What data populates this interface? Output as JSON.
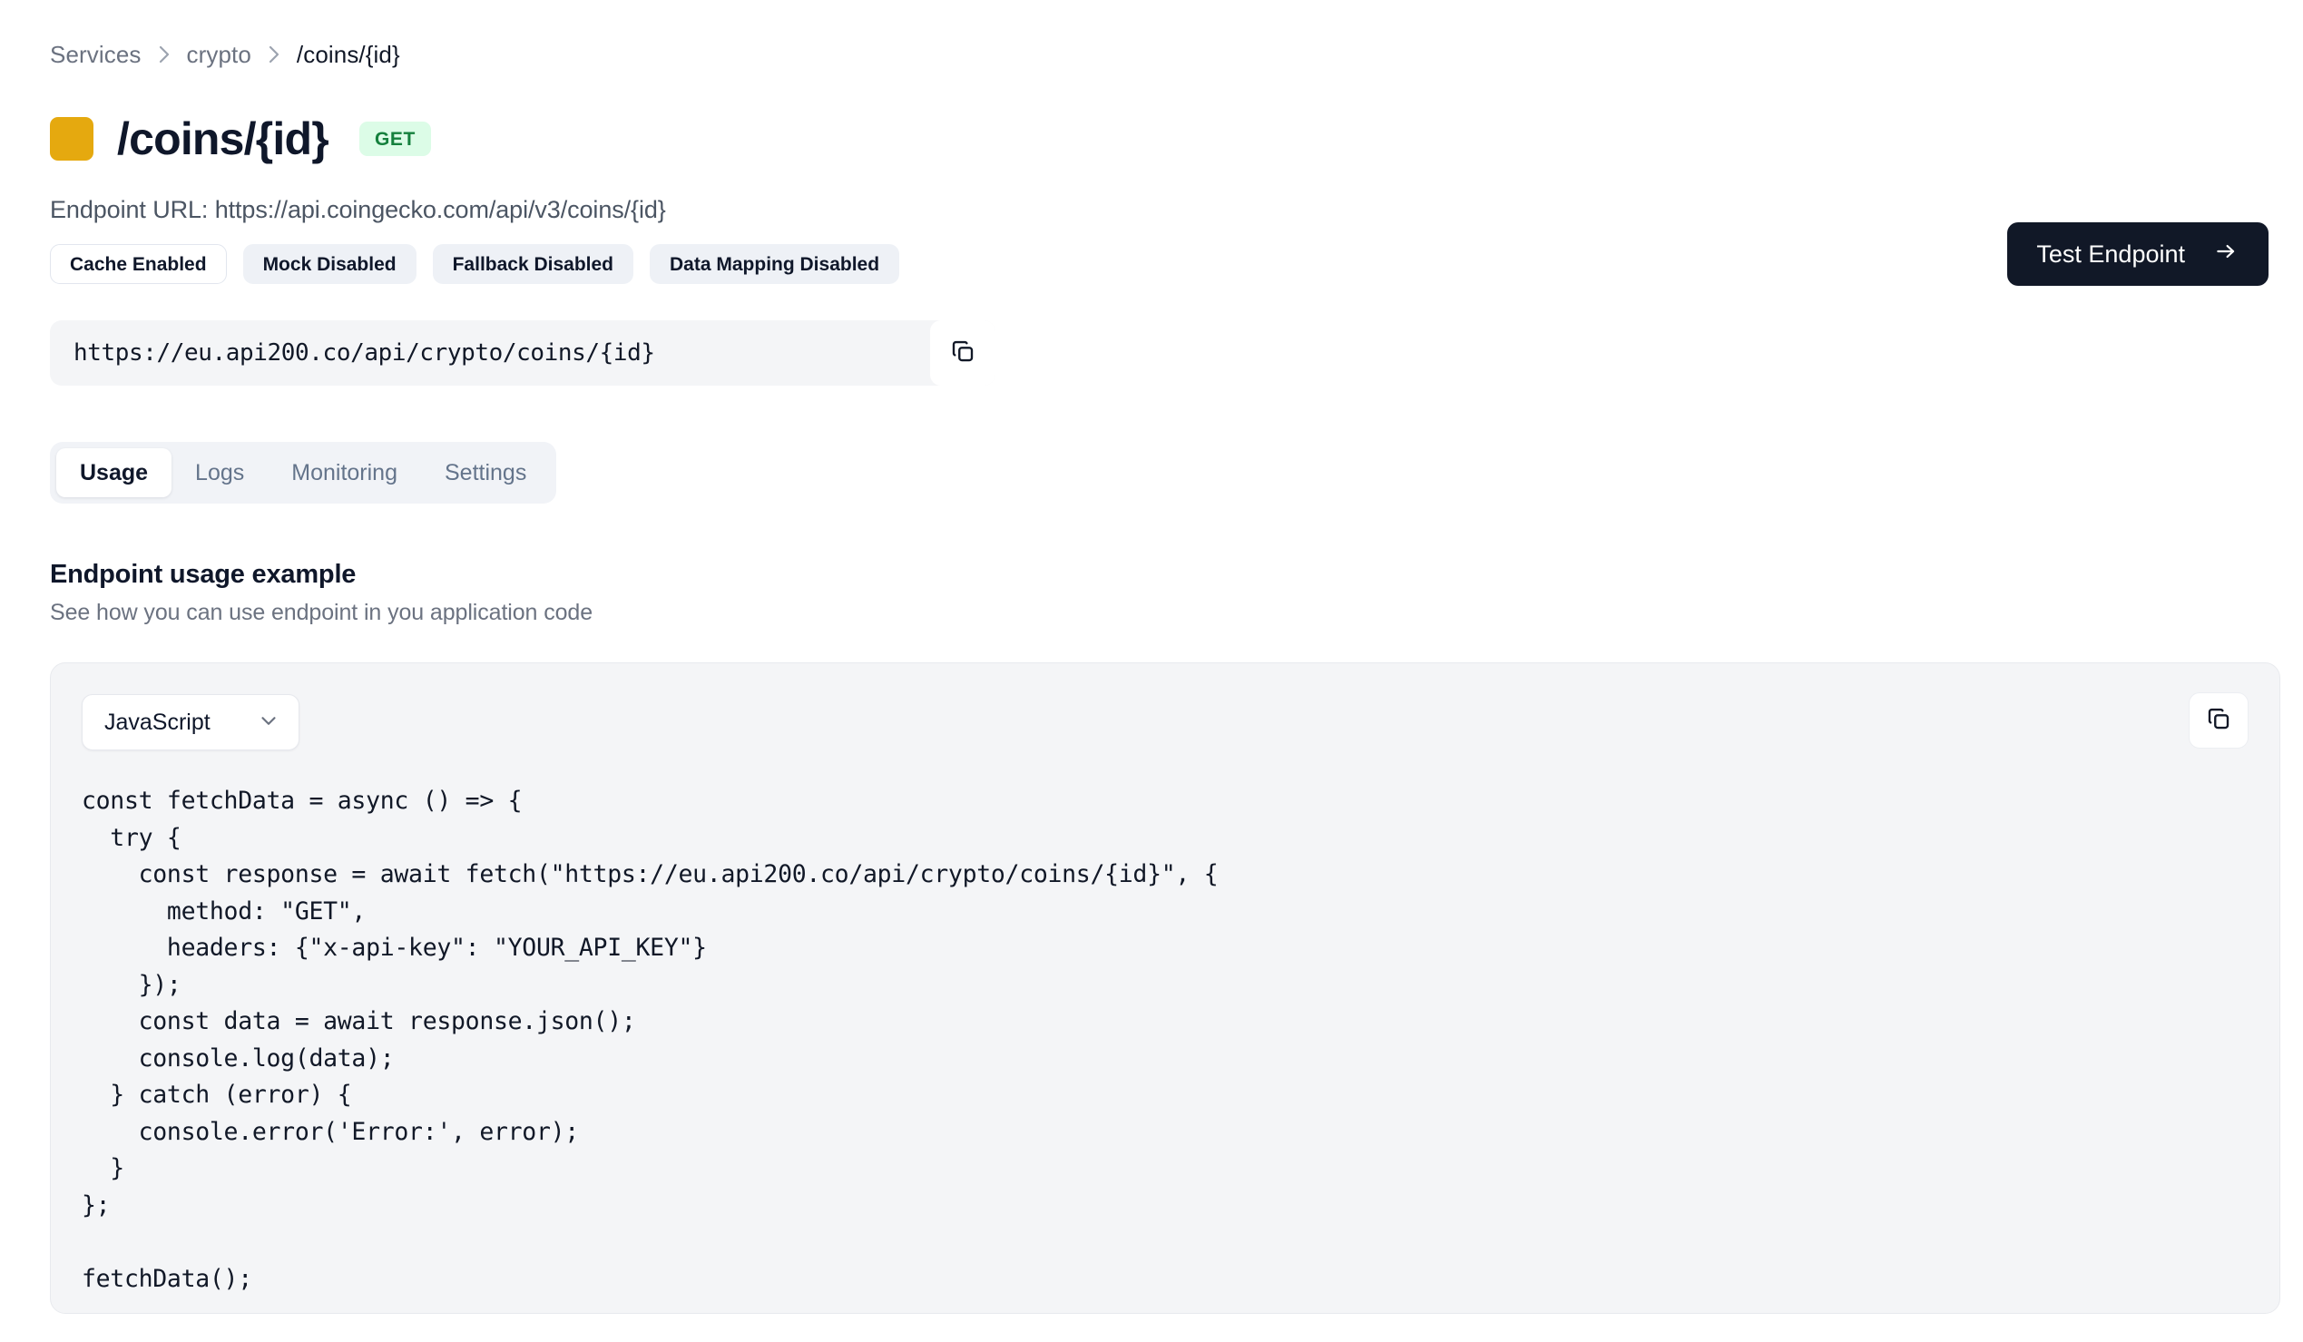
{
  "breadcrumb": {
    "items": [
      {
        "label": "Services",
        "current": false
      },
      {
        "label": "crypto",
        "current": false
      },
      {
        "label": "/coins/{id}",
        "current": true
      }
    ],
    "separator_icon": "chevron-right-icon"
  },
  "header": {
    "color_chip": "#e5a90f",
    "title": "/coins/{id}",
    "method": "GET",
    "method_bg": "#dcfce7",
    "method_color": "#15803d",
    "endpoint_url_line": "Endpoint URL: https://api.coingecko.com/api/v3/coins/{id}",
    "test_button": {
      "label": "Test Endpoint",
      "icon": "arrow-right-icon",
      "bg": "#111827"
    }
  },
  "feature_badges": [
    {
      "label": "Cache Enabled",
      "state": "enabled"
    },
    {
      "label": "Mock Disabled",
      "state": "disabled"
    },
    {
      "label": "Fallback Disabled",
      "state": "disabled"
    },
    {
      "label": "Data Mapping Disabled",
      "state": "disabled"
    }
  ],
  "proxy_url": {
    "value": "https://eu.api200.co/api/crypto/coins/{id}",
    "copy_icon": "copy-icon"
  },
  "tabs": [
    {
      "label": "Usage",
      "active": true
    },
    {
      "label": "Logs",
      "active": false
    },
    {
      "label": "Monitoring",
      "active": false
    },
    {
      "label": "Settings",
      "active": false
    }
  ],
  "usage_section": {
    "title": "Endpoint usage example",
    "subtitle": "See how you can use endpoint in you application code"
  },
  "code_panel": {
    "language_selected": "JavaScript",
    "language_chevron": "chevron-down-icon",
    "copy_icon": "copy-icon",
    "code": "const fetchData = async () => {\n  try {\n    const response = await fetch(\"https://eu.api200.co/api/crypto/coins/{id}\", {\n      method: \"GET\",\n      headers: {\"x-api-key\": \"YOUR_API_KEY\"}\n    });\n    const data = await response.json();\n    console.log(data);\n  } catch (error) {\n    console.error('Error:', error);\n  }\n};\n\nfetchData();"
  }
}
